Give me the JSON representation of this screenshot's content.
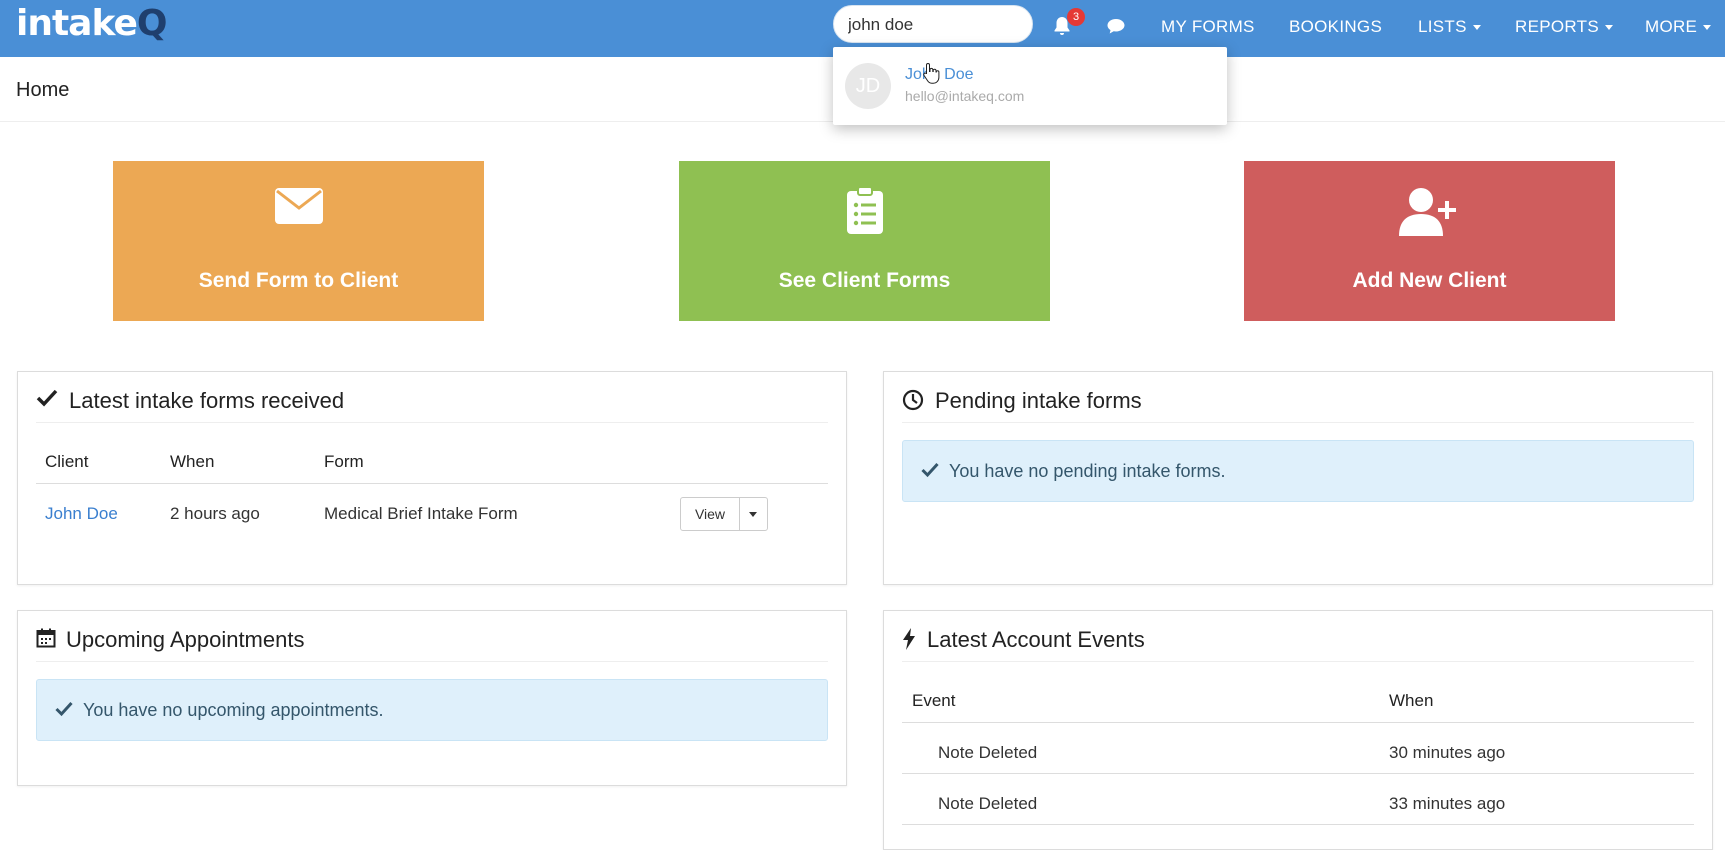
{
  "brand": {
    "logo_main": "intake",
    "logo_accent": "Q"
  },
  "search": {
    "value": "john doe",
    "placeholder": ""
  },
  "notifications": {
    "count": "3"
  },
  "nav": {
    "my_forms": "MY FORMS",
    "bookings": "BOOKINGS",
    "lists": "LISTS",
    "reports": "REPORTS",
    "more": "MORE"
  },
  "search_results": [
    {
      "initials": "JD",
      "name": "John Doe",
      "email": "hello@intakeq.com"
    }
  ],
  "page": {
    "title": "Home"
  },
  "tiles": {
    "send_form": "Send Form to Client",
    "see_forms": "See Client Forms",
    "add_client": "Add New Client"
  },
  "latest_forms": {
    "title": "Latest intake forms received",
    "columns": [
      "Client",
      "When",
      "Form"
    ],
    "rows": [
      {
        "client": "John Doe",
        "when": "2 hours ago",
        "form": "Medical Brief Intake Form",
        "action": "View"
      }
    ]
  },
  "pending_forms": {
    "title": "Pending intake forms",
    "message": "You have no pending intake forms."
  },
  "appointments": {
    "title": "Upcoming Appointments",
    "message": "You have no upcoming appointments."
  },
  "account_events": {
    "title": "Latest Account Events",
    "columns": [
      "Event",
      "When"
    ],
    "rows": [
      {
        "event": "Note Deleted",
        "when": "30 minutes ago"
      },
      {
        "event": "Note Deleted",
        "when": "33 minutes ago"
      }
    ]
  },
  "colors": {
    "navbar": "#4a8fd6",
    "tile_send": "#eca854",
    "tile_forms": "#8fc052",
    "tile_add": "#cf5d5d",
    "info_bg": "#dff0fb"
  }
}
